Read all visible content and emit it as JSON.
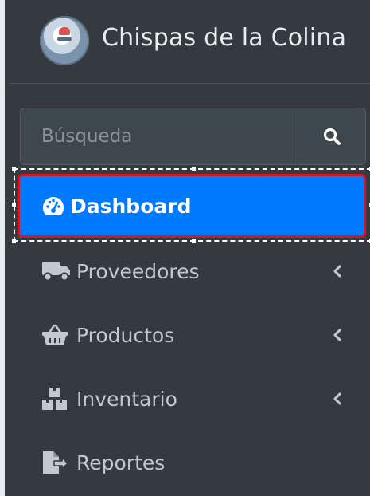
{
  "brand": {
    "name": "Chispas de la Colina"
  },
  "search": {
    "placeholder": "Búsqueda",
    "value": ""
  },
  "nav": [
    {
      "label": "Dashboard",
      "icon": "tachometer-icon",
      "active": true,
      "has_submenu": false
    },
    {
      "label": "Proveedores",
      "icon": "truck-icon",
      "active": false,
      "has_submenu": true
    },
    {
      "label": "Productos",
      "icon": "shopping-basket-icon",
      "active": false,
      "has_submenu": true
    },
    {
      "label": "Inventario",
      "icon": "boxes-icon",
      "active": false,
      "has_submenu": true
    },
    {
      "label": "Reportes",
      "icon": "file-export-icon",
      "active": false,
      "has_submenu": false
    }
  ],
  "colors": {
    "sidebar_bg": "#343a40",
    "active_bg": "#007bff",
    "text": "#c2c7d0",
    "highlight_border": "#d9141a"
  }
}
